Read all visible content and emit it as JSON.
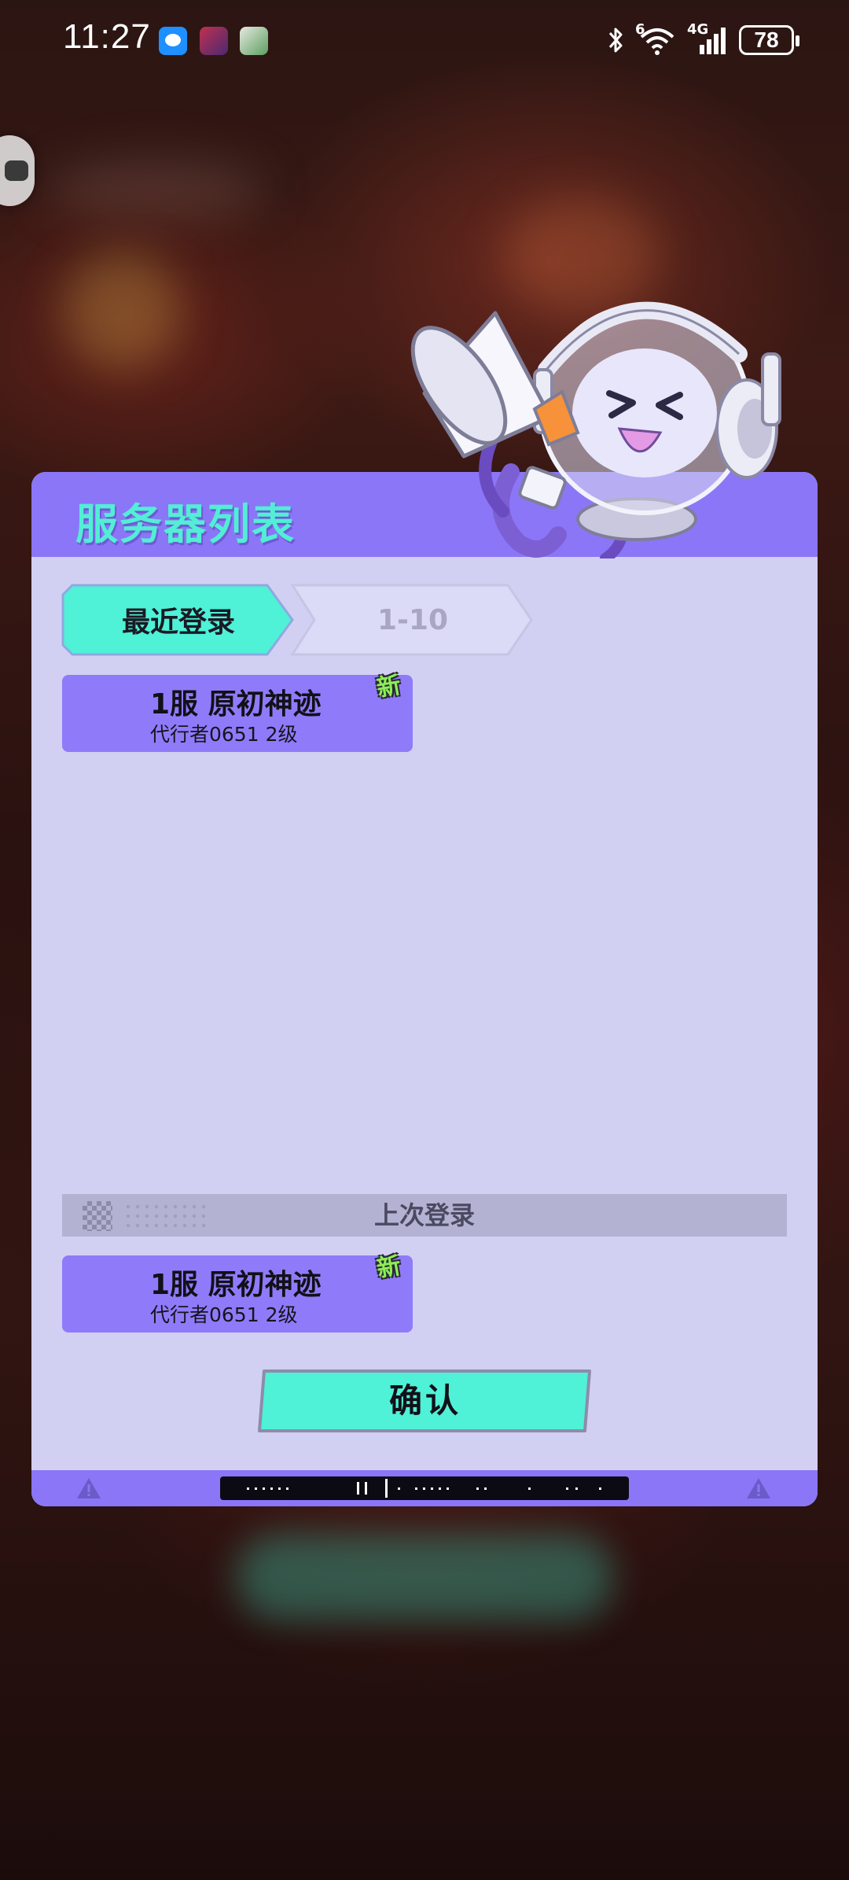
{
  "status_bar": {
    "time": "11:27",
    "network_label": "4G",
    "wifi_label": "6",
    "battery": "78"
  },
  "dialog": {
    "title": "服务器列表",
    "tabs": [
      {
        "label": "最近登录",
        "active": true
      },
      {
        "label": "1-10",
        "active": false
      }
    ],
    "recent_servers": [
      {
        "name": "1服 原初神迹",
        "detail": "代行者0651 2级",
        "badge": "新"
      }
    ],
    "last_login_label": "上次登录",
    "last_server": {
      "name": "1服 原初神迹",
      "detail": "代行者0651 2级",
      "badge": "新"
    },
    "confirm_label": "确认"
  },
  "colors": {
    "accent_purple": "#8b76f7",
    "accent_teal": "#4ff1d7",
    "panel_bg": "#d2d0f2",
    "badge_green": "#8dee56"
  },
  "icons": [
    "chat-app-icon",
    "game-app-icon",
    "panda-app-icon",
    "bluetooth-icon",
    "wifi-icon",
    "signal-icon",
    "battery-icon",
    "warning-icon",
    "mascot-megaphone"
  ]
}
